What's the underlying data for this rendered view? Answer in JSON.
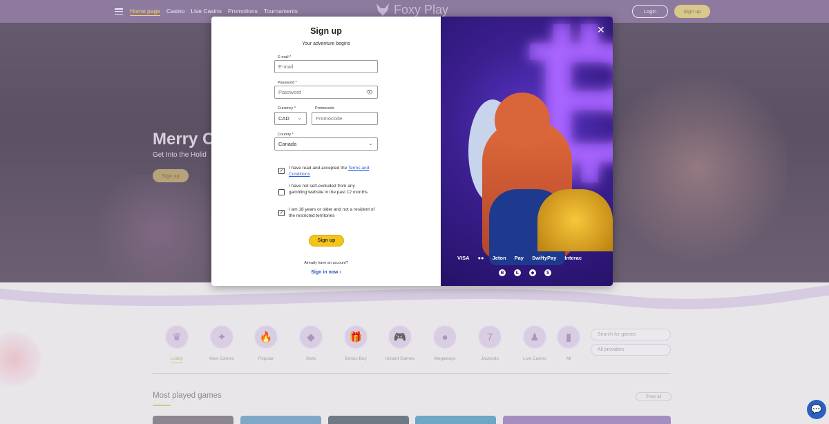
{
  "nav": {
    "links": [
      "Home page",
      "Casino",
      "Live Casino",
      "Promotions",
      "Tournaments"
    ],
    "logo_text": "Foxy Play",
    "login_label": "Login",
    "signup_label": "Sign up"
  },
  "hero": {
    "title": "Merry C",
    "subtitle": "Get Into the Holid",
    "button_label": "Sign up"
  },
  "categories": [
    {
      "label": "Lobby",
      "icon": "crown-icon",
      "glyph": "♛"
    },
    {
      "label": "New Games",
      "icon": "new-games-icon",
      "glyph": "✦"
    },
    {
      "label": "Popular",
      "icon": "flame-icon",
      "glyph": "🔥"
    },
    {
      "label": "Slots",
      "icon": "gem-icon",
      "glyph": "◆"
    },
    {
      "label": "Bonus Buy",
      "icon": "gift-icon",
      "glyph": "🎁"
    },
    {
      "label": "Instant Games",
      "icon": "gamepad-icon",
      "glyph": "🎮"
    },
    {
      "label": "Megaways",
      "icon": "megaways-icon",
      "glyph": "●"
    },
    {
      "label": "Jackpots",
      "icon": "jackpot-icon",
      "glyph": "7"
    },
    {
      "label": "Live Casino",
      "icon": "dealer-icon",
      "glyph": "♟"
    },
    {
      "label": "All",
      "icon": "all-games-icon",
      "glyph": "▮"
    }
  ],
  "search": {
    "placeholder": "Search for games",
    "providers": "All providers"
  },
  "section": {
    "title": "Most played games",
    "show_all": "Show all"
  },
  "modal": {
    "title": "Sign up",
    "subtitle": "Your adventure begins",
    "email_label": "E-mail *",
    "email_placeholder": "E-mail",
    "password_label": "Password *",
    "password_placeholder": "Password",
    "currency_label": "Currency *",
    "currency_value": "CAD",
    "promo_label": "Promocode",
    "promo_placeholder": "Promocode",
    "country_label": "Country *",
    "country_value": "Canada",
    "terms_prefix": "I have read and accepted the ",
    "terms_link": "Terms and Conditions",
    "terms_checked": true,
    "excluded_text": "I have not self-excluded from any gambling website in the past 12 months",
    "excluded_checked": false,
    "age_text": "I am 18 years or older and not a resident of the restricted territories",
    "age_checked": true,
    "submit_label": "Sign up",
    "already_text": "Already have an account?",
    "signin_label": "Sign in now ›",
    "payments": [
      "VISA",
      "●●",
      "Jeton",
      "Pay",
      "SwiftyPay",
      "Interac"
    ],
    "crypto": [
      "B",
      "Ł",
      "◆",
      "$"
    ]
  }
}
